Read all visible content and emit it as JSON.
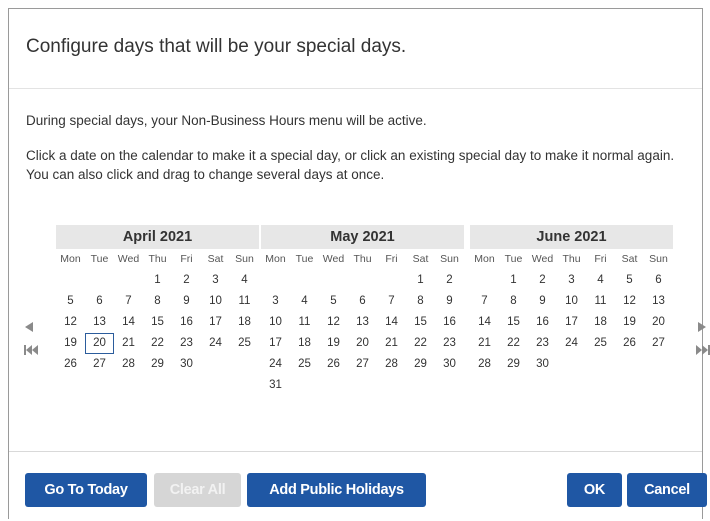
{
  "dialog": {
    "title": "Configure days that will be your special days.",
    "intro1": "During special days, your Non-Business Hours menu will be active.",
    "intro2": "Click a date on the calendar to make it a special day, or click an existing special day to make it normal again. You can also click and drag to change several days at once."
  },
  "calendar": {
    "weekday_labels": [
      "Mon",
      "Tue",
      "Wed",
      "Thu",
      "Fri",
      "Sat",
      "Sun"
    ],
    "highlighted_date": "20 April 2021",
    "months": [
      {
        "name": "April 2021",
        "weeks": [
          [
            "",
            "",
            "",
            "1",
            "2",
            "3",
            "4"
          ],
          [
            "5",
            "6",
            "7",
            "8",
            "9",
            "10",
            "11"
          ],
          [
            "12",
            "13",
            "14",
            "15",
            "16",
            "17",
            "18"
          ],
          [
            "19",
            "20",
            "21",
            "22",
            "23",
            "24",
            "25"
          ],
          [
            "26",
            "27",
            "28",
            "29",
            "30",
            "",
            ""
          ]
        ]
      },
      {
        "name": "May 2021",
        "weeks": [
          [
            "",
            "",
            "",
            "",
            "",
            "1",
            "2"
          ],
          [
            "3",
            "4",
            "5",
            "6",
            "7",
            "8",
            "9"
          ],
          [
            "10",
            "11",
            "12",
            "13",
            "14",
            "15",
            "16"
          ],
          [
            "17",
            "18",
            "19",
            "20",
            "21",
            "22",
            "23"
          ],
          [
            "24",
            "25",
            "26",
            "27",
            "28",
            "29",
            "30"
          ],
          [
            "31",
            "",
            "",
            "",
            "",
            "",
            ""
          ]
        ]
      },
      {
        "name": "June 2021",
        "weeks": [
          [
            "",
            "1",
            "2",
            "3",
            "4",
            "5",
            "6"
          ],
          [
            "7",
            "8",
            "9",
            "10",
            "11",
            "12",
            "13"
          ],
          [
            "14",
            "15",
            "16",
            "17",
            "18",
            "19",
            "20"
          ],
          [
            "21",
            "22",
            "23",
            "24",
            "25",
            "26",
            "27"
          ],
          [
            "28",
            "29",
            "30",
            "",
            "",
            "",
            ""
          ]
        ]
      }
    ],
    "nav_icons": {
      "prev_month": "triangle-left-icon",
      "first_page": "skip-back-icon",
      "next_month": "triangle-right-icon",
      "last_page": "skip-forward-icon"
    }
  },
  "buttons": {
    "go_to_today": "Go To Today",
    "clear_all": "Clear All",
    "add_public_holidays": "Add Public Holidays",
    "ok": "OK",
    "cancel": "Cancel"
  },
  "colors": {
    "primary_button": "#1f57a4",
    "disabled_button": "#d6d6d6",
    "month_header_bg": "#e7e7e7",
    "today_border": "#2b5c9c"
  }
}
